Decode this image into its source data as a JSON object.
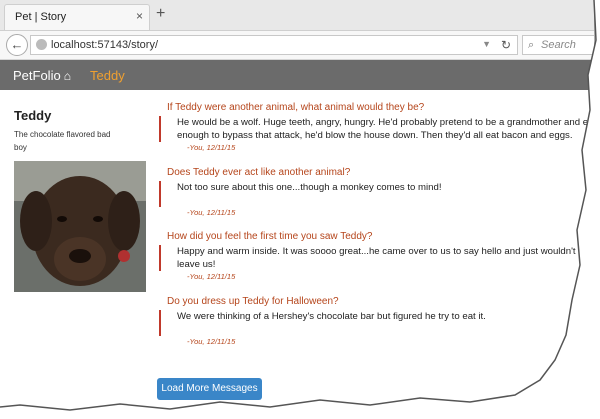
{
  "browser": {
    "tab_title": "Pet | Story",
    "tab_close": "×",
    "new_tab": "+",
    "back": "←",
    "url": "localhost:57143/story/",
    "search_placeholder": "Search"
  },
  "app": {
    "brand": "PetFolio",
    "nav_link": "Teddy"
  },
  "pet": {
    "name": "Teddy",
    "description": "The chocolate flavored bad boy"
  },
  "messages": [
    {
      "question": "If Teddy were another animal, what animal would they be?",
      "answer": "He would be a wolf.  Huge teeth, angry, hungry.  He'd probably pretend to be a grandmother and eat enough to bypass that attack, he'd blow the house down. Then they'd all eat bacon and eggs.",
      "by": "-You, 12/11/15"
    },
    {
      "question": "Does Teddy ever act like another animal?",
      "answer": "Not too sure about this one...though a monkey comes to mind!",
      "by": "-You, 12/11/15"
    },
    {
      "question": "How did you feel the first time you saw Teddy?",
      "answer": "Happy and warm inside.  It was soooo great...he came over to us to say hello and just wouldn't leave us!",
      "by": "-You, 12/11/15"
    },
    {
      "question": "Do you dress up Teddy for Halloween?",
      "answer": "We were thinking of a Hershey's chocolate bar but figured he try to eat it.",
      "by": "-You, 12/11/15"
    }
  ],
  "load_more": "Load More Messages",
  "colors": {
    "appbar": "#6b6b6b",
    "nav_link": "#f0a030",
    "question": "#b5451b",
    "accent_bar": "#c0392b",
    "button": "#3a86c8"
  }
}
